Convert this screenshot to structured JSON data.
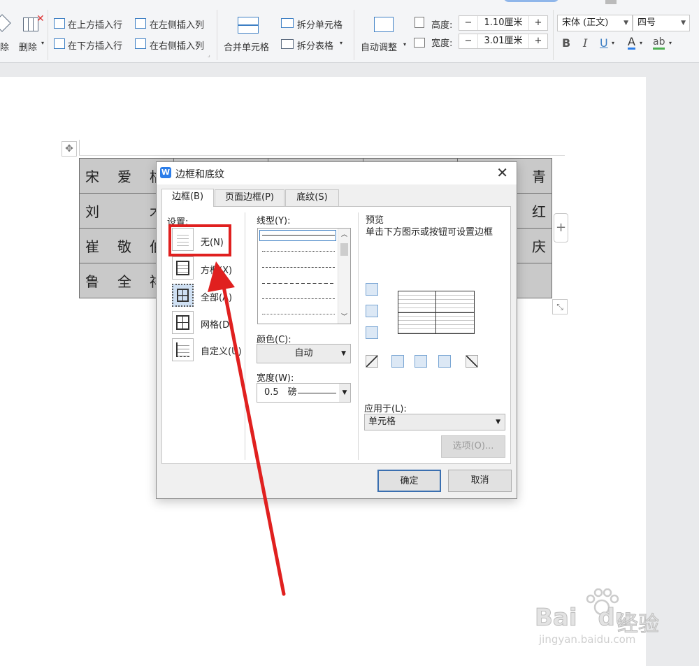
{
  "ribbon": {
    "delete_partial": "除",
    "delete": "删除",
    "insert_above": "在上方插入行",
    "insert_below": "在下方插入行",
    "insert_left": "在左侧插入列",
    "insert_right": "在右侧插入列",
    "merge_cells": "合并单元格",
    "split_cells": "拆分单元格",
    "split_table": "拆分表格",
    "auto_fit": "自动调整",
    "height_label": "高度:",
    "height_value": "1.10厘米",
    "width_label": "宽度:",
    "width_value": "3.01厘米",
    "minus": "−",
    "plus": "+",
    "font_name": "宋体 (正文)",
    "font_size": "四号",
    "bold": "B",
    "italic": "I",
    "underline": "U",
    "font_color": "A",
    "highlight": "ab"
  },
  "table": {
    "rows": [
      {
        "left": "宋爱枯",
        "right": "青"
      },
      {
        "left": "刘　术",
        "right": "红"
      },
      {
        "left": "崔敬伯",
        "right": "庆"
      },
      {
        "left": "鲁全祥",
        "right": ""
      }
    ]
  },
  "dialog": {
    "title": "边框和底纹",
    "logo": "W",
    "tabs": [
      "边框(B)",
      "页面边框(P)",
      "底纹(S)"
    ],
    "settings_label": "设置:",
    "settings": [
      {
        "label": "无(N)",
        "icon": "no-border-icon"
      },
      {
        "label": "方框(X)",
        "icon": "box-border-icon"
      },
      {
        "label": "全部(A)",
        "icon": "all-borders-icon"
      },
      {
        "label": "网格(D)",
        "icon": "grid-border-icon"
      },
      {
        "label": "自定义(U)",
        "icon": "custom-border-icon"
      }
    ],
    "line_style_label": "线型(Y):",
    "color_label": "颜色(C):",
    "color_value": "自动",
    "width_label": "宽度(W):",
    "width_value": "0.5　磅",
    "preview_label": "预览",
    "preview_hint": "单击下方图示或按钮可设置边框",
    "apply_label": "应用于(L):",
    "apply_value": "单元格",
    "options_button": "选项(O)...",
    "ok": "确定",
    "cancel": "取消"
  },
  "colors": {
    "highlight_box": "#e0201f",
    "arrow": "#e0201f",
    "table_fill": "#c9c9c9",
    "accent_blue": "#2b7de9"
  },
  "watermark": {
    "brand": "Bai",
    "brand2": "du",
    "cn": "经验",
    "url": "jingyan.baidu.com"
  }
}
